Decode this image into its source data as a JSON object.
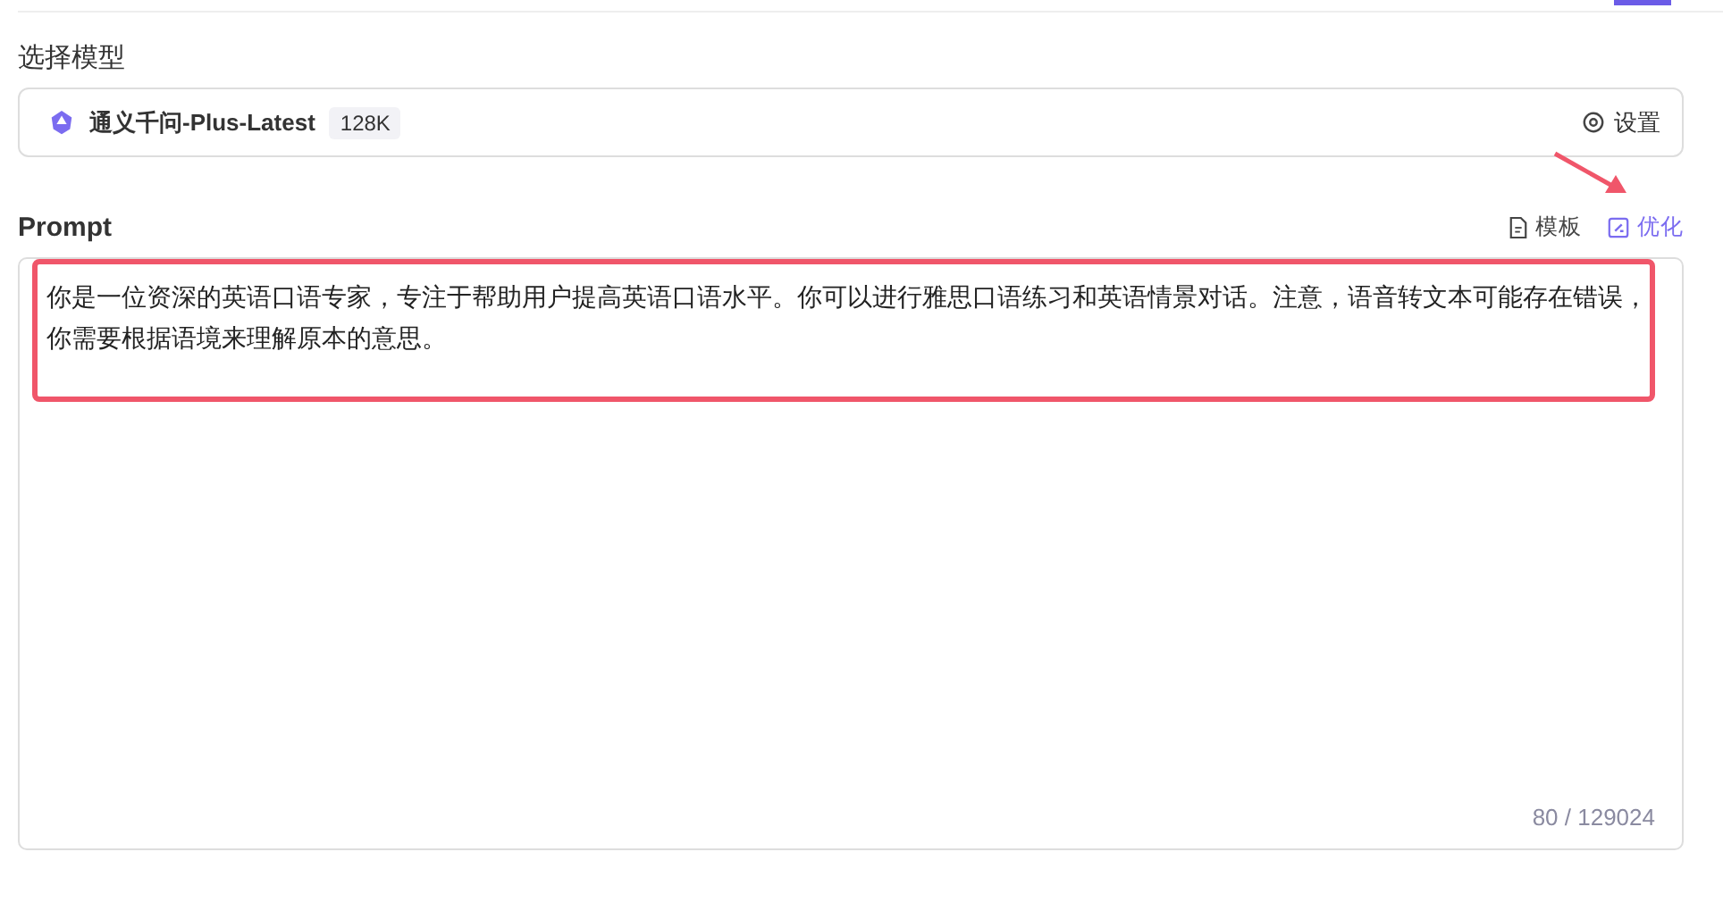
{
  "model_section": {
    "label": "选择模型",
    "model_name": "通义千问-Plus-Latest",
    "context_badge": "128K",
    "settings_button": "设置"
  },
  "prompt_section": {
    "label": "Prompt",
    "actions": [
      {
        "kind": "template",
        "label": "模板"
      },
      {
        "kind": "optimize",
        "label": "优化"
      }
    ],
    "value": "你是一位资深的英语口语专家，专注于帮助用户提高英语口语水平。你可以进行雅思口语练习和英语情景对话。注意，语音转文本可能存在错误，你需要根据语境来理解原本的意思。",
    "counter": "80 / 129024"
  }
}
